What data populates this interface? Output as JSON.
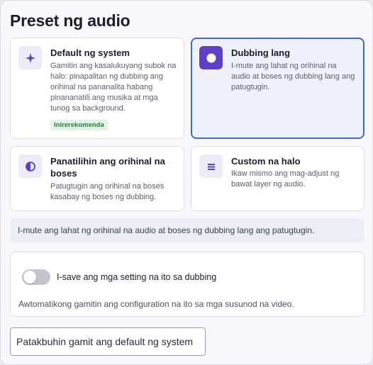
{
  "title": "Preset ng audio",
  "presets": [
    {
      "name": "Default ng system",
      "description": "Gamitin ang kasalukuyang subok na halo: pinapalitan ng dubbing ang orihinal na pananalita habang pinananatili ang musika at mga tunog sa background.",
      "badge": "Inirerekomenda",
      "icon": "sparkle-icon",
      "selected": false
    },
    {
      "name": "Dubbing lang",
      "description": "I-mute ang lahat ng orihinal na audio at boses ng dubbing lang ang patugtugin.",
      "icon": "record-circle-icon",
      "selected": true
    },
    {
      "name": "Panatilihin ang orihinal na boses",
      "description": "Patugtugin ang orihinal na boses kasabay ng boses ng dubbing.",
      "icon": "half-circle-icon",
      "selected": false
    },
    {
      "name": "Custom na halo",
      "description": "Ikaw mismo ang mag-adjust ng bawat layer ng audio.",
      "icon": "menu-lines-icon",
      "selected": false
    }
  ],
  "info_text": "I-mute ang lahat ng orihinal na audio at boses ng dubbing lang ang patugtugin.",
  "save_setting": {
    "label": "I-save ang mga setting na ito sa dubbing",
    "description": "Awtomatikong gamitin ang configuration na ito sa mga susunod na video.",
    "enabled": false
  },
  "reset_button": "Patakbuhin gamit ang default ng system",
  "colors": {
    "accent": "#5e3fc6",
    "selected_border": "#3a6ebe",
    "badge_bg": "#e3f4e6",
    "badge_text": "#2d7a40"
  }
}
